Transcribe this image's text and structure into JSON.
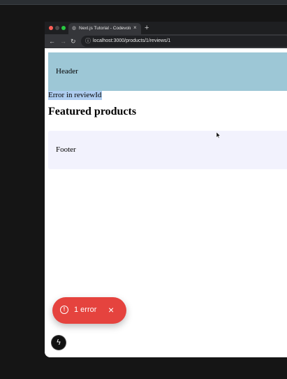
{
  "browser": {
    "tab_title": "Next.js Tutorial - Codevolution",
    "tab_close_glyph": "×",
    "new_tab_glyph": "+",
    "nav": {
      "back": "←",
      "forward": "→",
      "reload": "↻"
    },
    "url": "localhost:3000/products/1/reviews/1"
  },
  "page": {
    "header": "Header",
    "error_text": "Error in reviewId",
    "featured_heading": "Featured products",
    "footer": "Footer"
  },
  "toast": {
    "icon_glyph": "!",
    "label": "1 error",
    "close_glyph": "×"
  },
  "dev_indicator": {
    "glyph": "ϟ"
  },
  "colors": {
    "background": "#151515",
    "header_bg": "#9dc7d6",
    "footer_bg": "#f2f2fd",
    "selection": "#aecdf0",
    "toast_bg": "#e5433e"
  }
}
